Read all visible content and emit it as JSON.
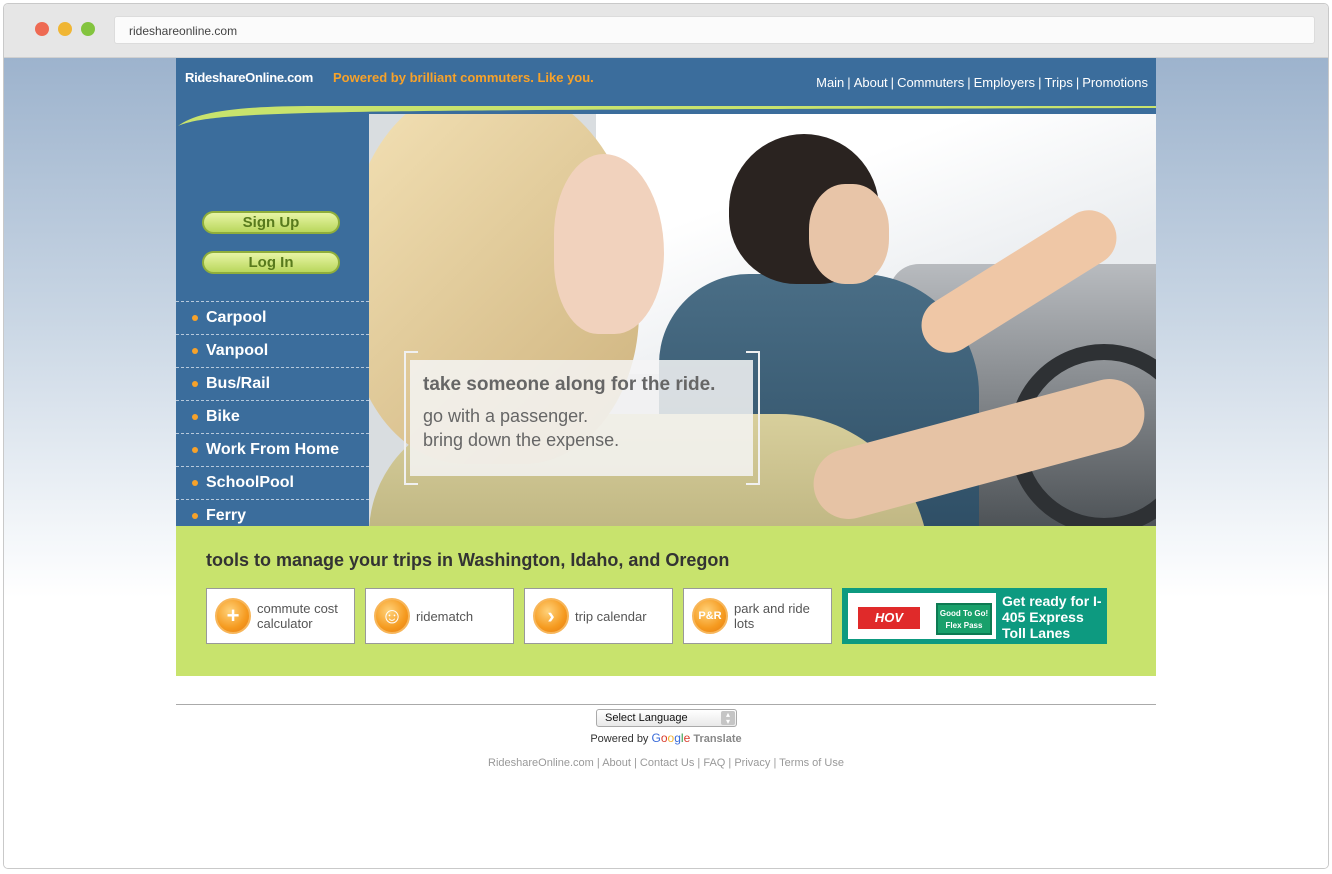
{
  "browser": {
    "url": "rideshareonline.com"
  },
  "header": {
    "logo": "RideshareOnline.com",
    "tagline": "Powered by brilliant commuters. Like you.",
    "nav": [
      "Main",
      "About",
      "Commuters",
      "Employers",
      "Trips",
      "Promotions"
    ]
  },
  "sidebar": {
    "signup": "Sign Up",
    "login": "Log In",
    "items": [
      "Carpool",
      "Vanpool",
      "Bus/Rail",
      "Bike",
      "Work From Home",
      "SchoolPool",
      "Ferry"
    ]
  },
  "hero": {
    "line1": "take someone along for the ride.",
    "line2": "go with a passenger.",
    "line3": "bring down the expense."
  },
  "tools": {
    "title": "tools to manage your trips in Washington, Idaho, and Oregon",
    "items": [
      {
        "label": "commute cost calculator",
        "icon": "plus-icon"
      },
      {
        "label": "ridematch",
        "icon": "people-icon"
      },
      {
        "label": "trip calendar",
        "icon": "arrow-right-icon"
      },
      {
        "label": "park and ride lots",
        "icon": "park-ride-icon",
        "badge": "P&R"
      }
    ],
    "ad": {
      "hov": "HOV",
      "pass": "Good To Go! Flex Pass",
      "text": "Get ready for I-405 Express Toll Lanes"
    }
  },
  "footer": {
    "language_select": "Select Language",
    "powered_by": "Powered by",
    "google": "Google",
    "translate": "Translate",
    "links": [
      "RideshareOnline.com",
      "About",
      "Contact Us",
      "FAQ",
      "Privacy",
      "Terms of Use"
    ]
  },
  "colors": {
    "header_blue": "#3b6d9c",
    "accent_orange": "#f7a22a",
    "tools_green": "#c8e36d"
  }
}
